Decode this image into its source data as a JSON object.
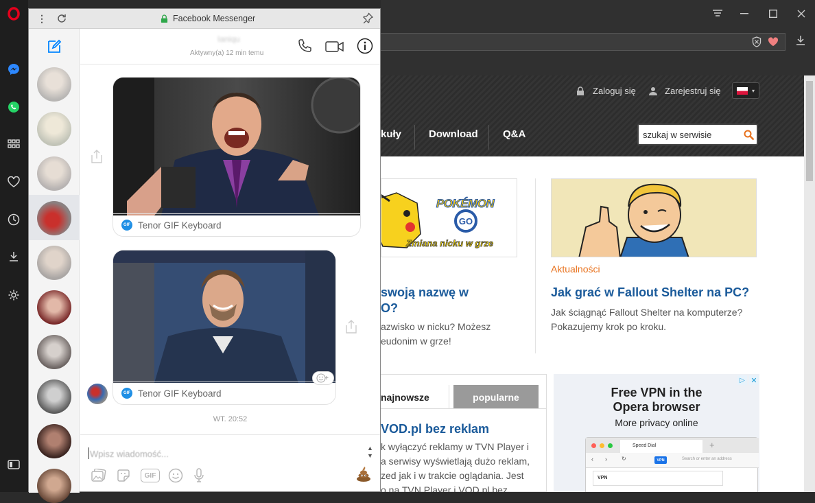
{
  "messenger": {
    "window_title": "Facebook Messenger",
    "contact_name": "Ianiqu",
    "contact_status": "Aktywny(a) 12 min temu",
    "gifs": [
      {
        "source_label": "Tenor GIF Keyboard"
      },
      {
        "source_label": "Tenor GIF Keyboard"
      }
    ],
    "timestamp": "WT. 20:52",
    "composer_placeholder": "Wpisz wiadomość...",
    "composer_tools": [
      "image-icon",
      "sticker-icon",
      "gif-icon",
      "emoji-icon",
      "microphone-icon"
    ],
    "gif_tool_label": "GIF",
    "contacts_count_visible": 10
  },
  "site": {
    "login": "Zaloguj się",
    "register": "Zarejestruj się",
    "nav": [
      "kuły",
      "Download",
      "Q&A"
    ],
    "search_placeholder": "szukaj w serwisie",
    "pokemon_caption": "Zmiana nicku w grze",
    "pokemon_logo": "POKÉMON",
    "pokemon_logo_sub": "GO",
    "left_article": {
      "title_line1": "swoją nazwę w",
      "title_line2": "O?",
      "text_line1": "azwisko w nicku? Możesz",
      "text_line2": "eudonim w grze!"
    },
    "right_article": {
      "category": "Aktualności",
      "title": "Jak grać w Fallout Shelter na PC?",
      "text_line1": "Jak ściągnąć Fallout Shelter na komputerze?",
      "text_line2": "Pokazujemy krok po kroku."
    },
    "tabs": [
      "najnowsze",
      "popularne"
    ],
    "vod": {
      "title": "VOD.pl bez reklam",
      "lines": [
        "k wyłączyć reklamy w TVN Player i",
        "a serwisy wyświetlają dużo reklam,",
        "zed jak i w trakcie oglądania. Jest",
        "o na TVN Player i VOD.pl bez"
      ]
    },
    "ad": {
      "line1": "Free VPN in the",
      "line2": "Opera browser",
      "line3": "More privacy online",
      "mock_tab": "Speed Dial",
      "mock_search": "Search or enter an address",
      "mock_vpn": "VPN",
      "mock_panel": "VPN"
    }
  },
  "colors": {
    "opera_red": "#e5001c",
    "messenger_blue": "#0084ff",
    "link_blue": "#1a5a9a",
    "orange": "#e8711c",
    "active_tab": "#ffffff",
    "inactive_tab": "#9a9a9a"
  }
}
